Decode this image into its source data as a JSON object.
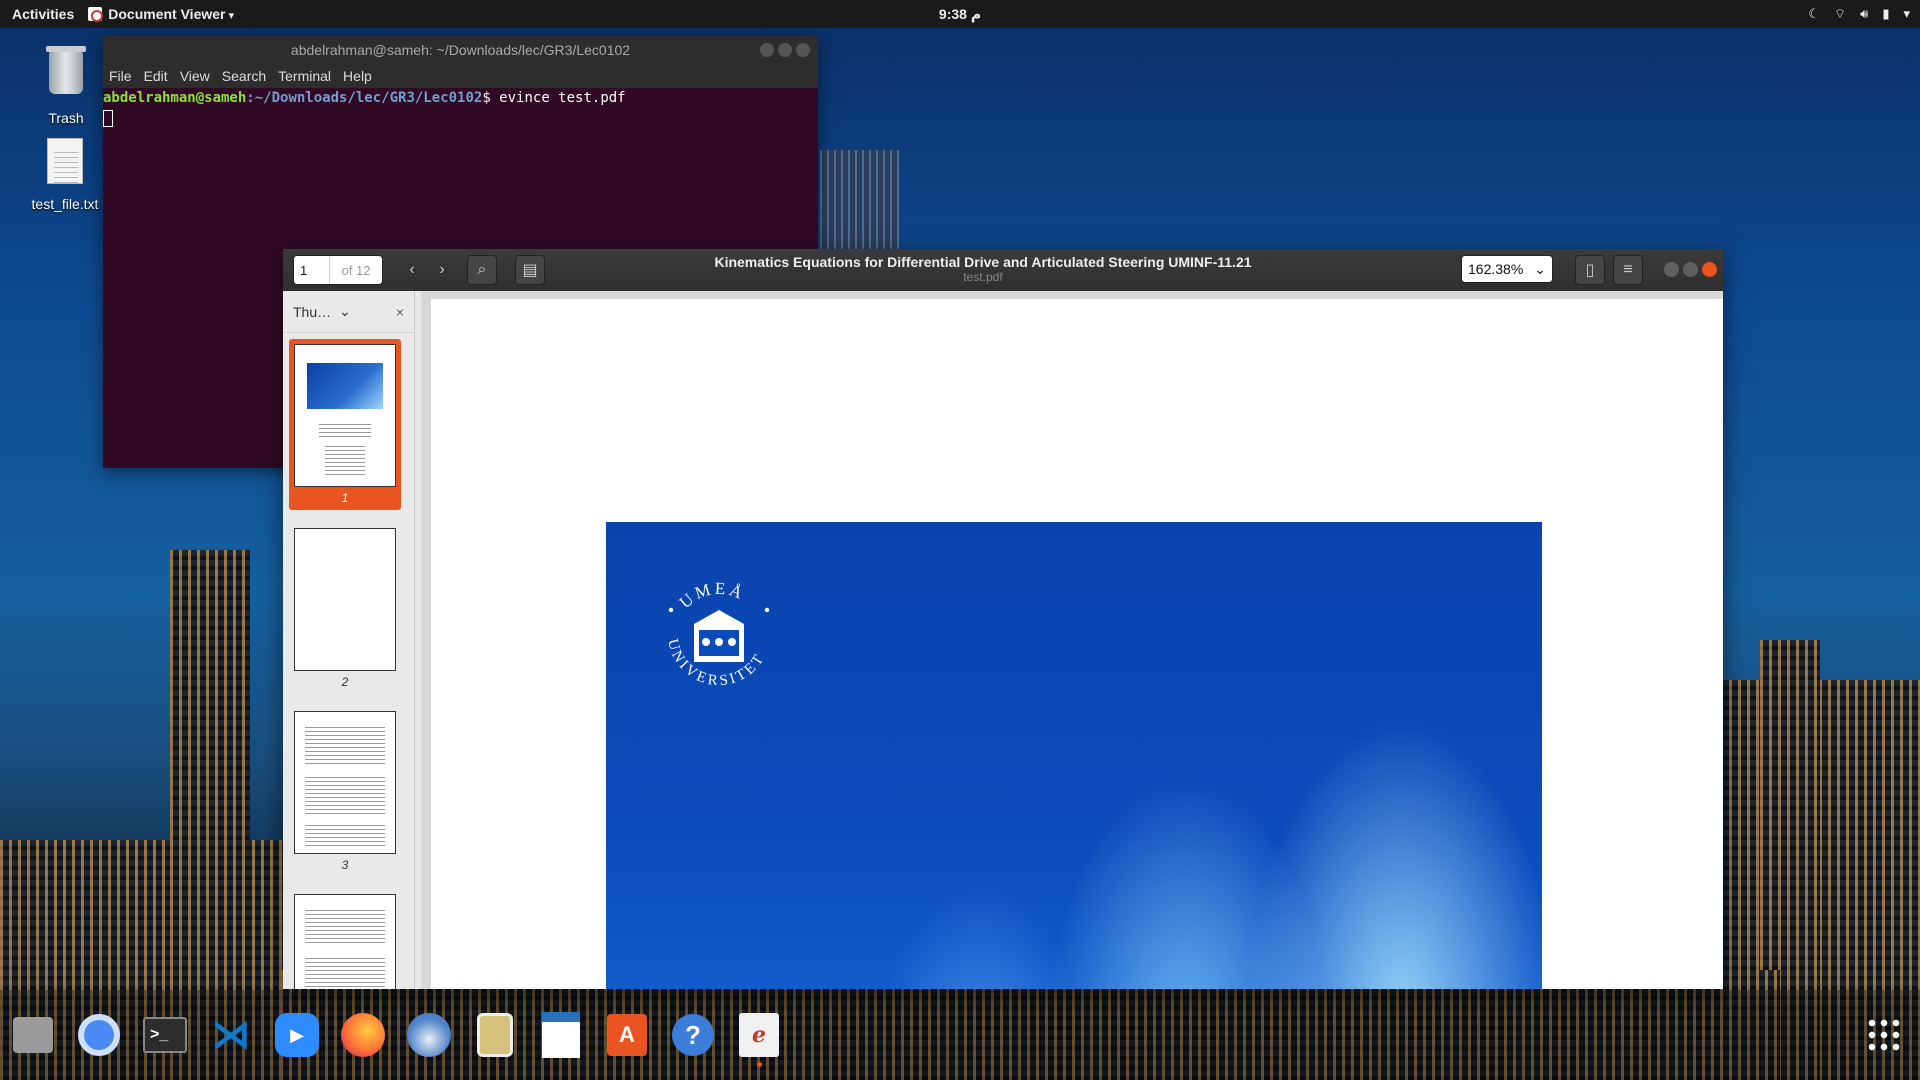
{
  "topbar": {
    "activities": "Activities",
    "app_menu": "Document Viewer",
    "clock": "9:38 م"
  },
  "desktop": {
    "icons": [
      {
        "label": "Trash"
      },
      {
        "label": "test_file.txt"
      }
    ]
  },
  "terminal": {
    "title": "abdelrahman@sameh: ~/Downloads/lec/GR3/Lec0102",
    "menu": [
      "File",
      "Edit",
      "View",
      "Search",
      "Terminal",
      "Help"
    ],
    "prompt_user": "abdelrahman@sameh",
    "prompt_path": ":~/Downloads/lec/GR3/Lec0102",
    "command": "$ evince test.pdf"
  },
  "evince": {
    "page_number": "1",
    "page_of": "of 12",
    "title": "Kinematics Equations for Differential Drive  and Articulated Steering UMINF-11.21",
    "subtitle": "test.pdf",
    "zoom": "162.38%",
    "sidebar": {
      "mode": "Thu…",
      "thumbnails": [
        {
          "label": "1",
          "selected": true
        },
        {
          "label": "2",
          "selected": false
        },
        {
          "label": "3",
          "selected": false
        }
      ]
    },
    "seal_text_top": "UMEÅ",
    "seal_text_bottom": "UNIVERSITET"
  },
  "dock": {
    "apps": [
      {
        "name": "files",
        "icon": "files-icon",
        "color": "#8d8d8d"
      },
      {
        "name": "chromium",
        "icon": "chromium-icon",
        "color": "#4a8af4"
      },
      {
        "name": "terminal",
        "icon": "terminal-icon",
        "color": "#2c2c2c"
      },
      {
        "name": "vscode",
        "icon": "vscode-icon",
        "color": "#0e7acc"
      },
      {
        "name": "zoom",
        "icon": "zoom-icon",
        "color": "#2d8cff"
      },
      {
        "name": "firefox",
        "icon": "firefox-icon",
        "color": "#ff7139"
      },
      {
        "name": "thunderbird",
        "icon": "thunderbird-icon",
        "color": "#4f83c9"
      },
      {
        "name": "rhythmbox",
        "icon": "rhythmbox-icon",
        "color": "#d6c27a"
      },
      {
        "name": "writer",
        "icon": "writer-icon",
        "color": "#2a6fb8"
      },
      {
        "name": "software",
        "icon": "software-icon",
        "color": "#e95420"
      },
      {
        "name": "help",
        "icon": "help-icon",
        "color": "#3b7dd8"
      },
      {
        "name": "document-viewer",
        "icon": "document-viewer-icon",
        "color": "#f1f1f1"
      }
    ]
  },
  "colors": {
    "accent": "#e95420",
    "terminal_bg": "#300a24",
    "cover_blue": "#0b4cbc"
  }
}
